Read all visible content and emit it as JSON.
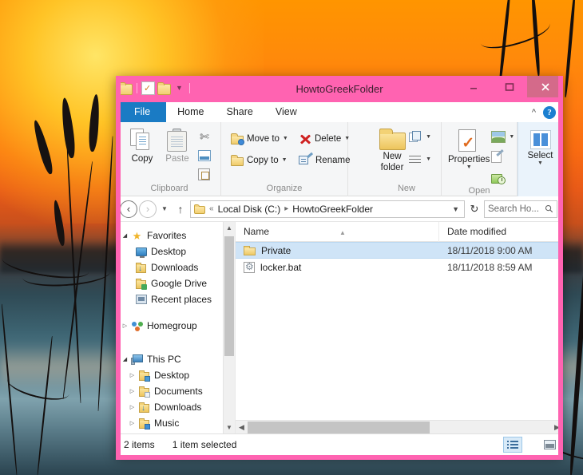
{
  "window": {
    "title": "HowtoGreekFolder",
    "quick_access": [
      "folder-icon",
      "properties-icon",
      "new-folder-icon",
      "customize-dropdown-icon"
    ],
    "controls": {
      "minimize": "–",
      "maximize": "□",
      "close": "✕"
    },
    "accent_color": "#ff63b1",
    "file_tab_color": "#1a7bc4"
  },
  "tabs": {
    "file": "File",
    "items": [
      "Home",
      "Share",
      "View"
    ],
    "active": "Home",
    "collapse_icon": "chevron-up-icon",
    "help_icon": "help-icon",
    "help_glyph": "?"
  },
  "ribbon": {
    "groups": [
      {
        "label": "Clipboard",
        "big_buttons": [
          {
            "name": "copy",
            "label": "Copy",
            "enabled": true
          },
          {
            "name": "paste",
            "label": "Paste",
            "enabled": false
          }
        ],
        "small_buttons": [
          {
            "name": "cut",
            "label": "",
            "icon": "scissors-icon"
          },
          {
            "name": "copy-path",
            "label": "",
            "icon": "copy-path-icon"
          },
          {
            "name": "paste-shortcut",
            "label": "",
            "icon": "paste-shortcut-icon"
          }
        ]
      },
      {
        "label": "Organize",
        "small_buttons": [
          {
            "name": "move-to",
            "label": "Move to",
            "icon": "move-to-icon",
            "dropdown": true
          },
          {
            "name": "copy-to",
            "label": "Copy to",
            "icon": "copy-to-icon",
            "dropdown": true
          },
          {
            "name": "delete",
            "label": "Delete",
            "icon": "delete-icon",
            "dropdown": true
          },
          {
            "name": "rename",
            "label": "Rename",
            "icon": "rename-icon",
            "dropdown": false
          }
        ]
      },
      {
        "label": "New",
        "big_buttons": [
          {
            "name": "new-folder",
            "label": "New\nfolder",
            "line1": "New",
            "line2": "folder"
          }
        ],
        "small_buttons": [
          {
            "name": "new-item",
            "label": "",
            "icon": "new-item-icon",
            "dropdown": true
          },
          {
            "name": "easy-access",
            "label": "",
            "icon": "easy-access-icon",
            "dropdown": true
          }
        ]
      },
      {
        "label": "Open",
        "big_buttons": [
          {
            "name": "properties",
            "label": "Properties",
            "dropdown": true
          }
        ],
        "small_buttons": [
          {
            "name": "open",
            "label": "",
            "icon": "open-icon",
            "dropdown": true
          },
          {
            "name": "edit",
            "label": "",
            "icon": "edit-icon"
          },
          {
            "name": "history",
            "label": "",
            "icon": "history-icon"
          }
        ]
      },
      {
        "label": "",
        "big_buttons": [
          {
            "name": "select",
            "label": "Select",
            "dropdown": true
          }
        ]
      }
    ],
    "labels": {
      "clipboard": "Clipboard",
      "organize": "Organize",
      "new": "New",
      "open": "Open",
      "select_group": ""
    }
  },
  "addressbar": {
    "back_icon": "back-arrow-icon",
    "forward_icon": "forward-arrow-icon",
    "recent_icon": "chevron-down-icon",
    "up_icon": "up-arrow-icon",
    "folder_icon": "folder-icon",
    "overflow": "«",
    "crumbs": [
      "Local Disk (C:)",
      "HowtoGreekFolder"
    ],
    "crumb_separator": "▸",
    "dropdown_icon": "chevron-down-icon",
    "refresh_icon": "refresh-icon",
    "refresh_glyph": "↻",
    "search_placeholder": "Search Ho...",
    "search_icon": "search-icon"
  },
  "navpane": {
    "items": [
      {
        "label": "Favorites",
        "icon": "star-icon",
        "indent": 0,
        "expander": "expanded"
      },
      {
        "label": "Desktop",
        "icon": "monitor-icon",
        "indent": 1,
        "expander": "none"
      },
      {
        "label": "Downloads",
        "icon": "downloads-icon",
        "indent": 1,
        "expander": "none"
      },
      {
        "label": "Google Drive",
        "icon": "google-drive-icon",
        "indent": 1,
        "expander": "none"
      },
      {
        "label": "Recent places",
        "icon": "recent-places-icon",
        "indent": 1,
        "expander": "none"
      },
      {
        "label": "Homegroup",
        "icon": "homegroup-icon",
        "indent": 0,
        "expander": "collapsed",
        "spacer_before": true
      },
      {
        "label": "This PC",
        "icon": "this-pc-icon",
        "indent": 0,
        "expander": "expanded",
        "spacer_before": true
      },
      {
        "label": "Desktop",
        "icon": "folder-desktop-icon",
        "indent": 1,
        "expander": "collapsed"
      },
      {
        "label": "Documents",
        "icon": "folder-documents-icon",
        "indent": 1,
        "expander": "collapsed"
      },
      {
        "label": "Downloads",
        "icon": "folder-downloads-icon",
        "indent": 1,
        "expander": "collapsed"
      },
      {
        "label": "Music",
        "icon": "folder-music-icon",
        "indent": 1,
        "expander": "collapsed"
      }
    ],
    "scroll_up_icon": "chevron-up-icon",
    "scroll_down_icon": "chevron-down-icon"
  },
  "filelist": {
    "columns": [
      {
        "key": "name",
        "label": "Name",
        "sorted": true,
        "sort_icon": "sort-ascending-icon"
      },
      {
        "key": "date",
        "label": "Date modified",
        "sorted": false
      }
    ],
    "rows": [
      {
        "name": "Private",
        "date": "18/11/2018 9:00 AM",
        "icon": "folder-icon",
        "selected": true
      },
      {
        "name": "locker.bat",
        "date": "18/11/2018 8:59 AM",
        "icon": "batch-file-icon",
        "selected": false
      }
    ],
    "hscroll_left_icon": "chevron-left-icon",
    "hscroll_right_icon": "chevron-right-icon"
  },
  "statusbar": {
    "item_count": "2 items",
    "selection": "1 item selected",
    "views": [
      {
        "name": "details-view",
        "icon": "details-view-icon",
        "active": true
      },
      {
        "name": "large-icons-view",
        "icon": "large-icons-view-icon",
        "active": false
      }
    ]
  }
}
